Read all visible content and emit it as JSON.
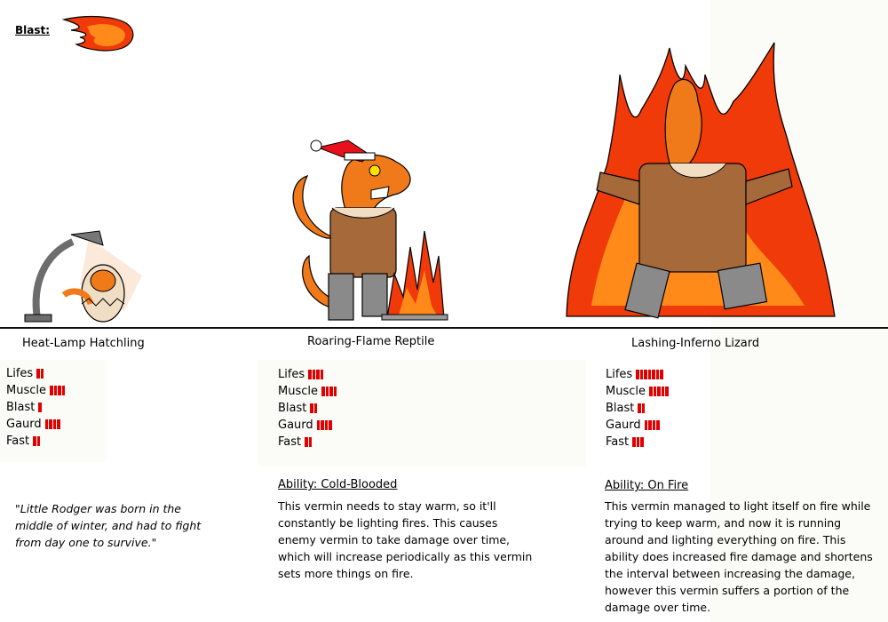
{
  "header": {
    "blast_label": "Blast:"
  },
  "colors": {
    "bar": "#e00000",
    "fire_red": "#f03a0a",
    "fire_orange": "#ff7a00",
    "body_orange": "#f07a1a",
    "coat_brown": "#a5693a",
    "boot_grey": "#8a8a8a"
  },
  "creatures": [
    {
      "name": "Heat-Lamp Hatchling",
      "stats": [
        {
          "label": "Lifes",
          "value": 2
        },
        {
          "label": "Muscle",
          "value": 4
        },
        {
          "label": "Blast",
          "value": 1
        },
        {
          "label": "Gaurd",
          "value": 4
        },
        {
          "label": "Fast",
          "value": 2
        }
      ],
      "quote": "\"Little Rodger was born in the middle of winter, and had to fight from day one to survive.\""
    },
    {
      "name": "Roaring-Flame Reptile",
      "stats": [
        {
          "label": "Lifes",
          "value": 4
        },
        {
          "label": "Muscle",
          "value": 4
        },
        {
          "label": "Blast",
          "value": 2
        },
        {
          "label": "Gaurd",
          "value": 4
        },
        {
          "label": "Fast",
          "value": 2
        }
      ],
      "ability_title": "Ability: Cold-Blooded",
      "ability_text": "This vermin needs to stay warm, so it'll constantly be lighting fires. This causes enemy vermin to take damage over time, which will increase periodically as this vermin sets more things on fire."
    },
    {
      "name": "Lashing-Inferno Lizard",
      "stats": [
        {
          "label": "Lifes",
          "value": 7
        },
        {
          "label": "Muscle",
          "value": 5
        },
        {
          "label": "Blast",
          "value": 2
        },
        {
          "label": "Gaurd",
          "value": 4
        },
        {
          "label": "Fast",
          "value": 3
        }
      ],
      "ability_title": "Ability: On Fire",
      "ability_text": "This vermin managed to light itself on fire while trying to keep warm, and now it is running around and lighting everything on fire. This ability does increased fire damage and shortens the interval between increasing the damage, however this vermin suffers a portion of the damage over time."
    }
  ]
}
